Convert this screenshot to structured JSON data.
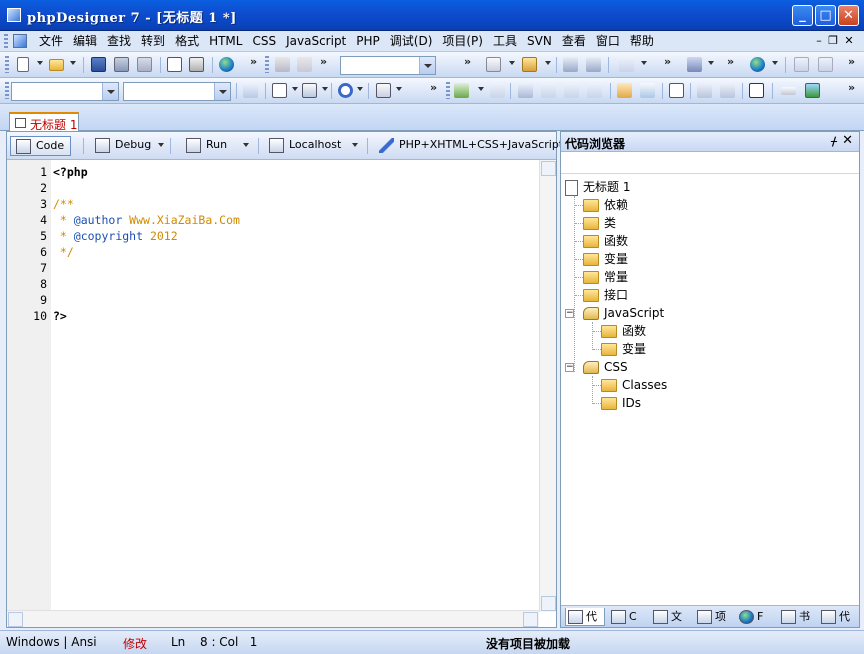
{
  "window": {
    "title": "phpDesigner 7 - [无标题 1 *]",
    "buttons": {
      "minimize": "_",
      "maximize": "□",
      "close": "✕"
    }
  },
  "menu": {
    "items": [
      "文件",
      "编辑",
      "查找",
      "转到",
      "格式",
      "HTML",
      "CSS",
      "JavaScript",
      "PHP",
      "调试(D)",
      "项目(P)",
      "工具",
      "SVN",
      "查看",
      "窗口",
      "帮助"
    ],
    "mdi_minimize": "–",
    "mdi_restore": "❐",
    "mdi_close": "✕"
  },
  "document_tab": {
    "label": "无标题 1"
  },
  "editor_toolbar": {
    "code_label": "Code",
    "debug_label": "Debug",
    "run_label": "Run",
    "localhost_label": "Localhost",
    "syntax_label": "PHP+XHTML+CSS+JavaScript"
  },
  "code_lines": [
    {
      "n": "1",
      "text": "<?php",
      "style": "kw"
    },
    {
      "n": "2",
      "text": "",
      "style": ""
    },
    {
      "n": "3",
      "text": "/**",
      "style": "cm"
    },
    {
      "n": "4",
      "text": " * @author Www.XiaZaiBa.Com",
      "style": "cm",
      "tag": "@author",
      "rest": " Www.XiaZaiBa.Com",
      "pre": " * "
    },
    {
      "n": "5",
      "text": " * @copyright 2012",
      "style": "cm",
      "tag": "@copyright",
      "rest": " 2012",
      "pre": " * "
    },
    {
      "n": "6",
      "text": " */",
      "style": "cm"
    },
    {
      "n": "7",
      "text": "",
      "style": ""
    },
    {
      "n": "8",
      "text": "",
      "style": ""
    },
    {
      "n": "9",
      "text": "",
      "style": ""
    },
    {
      "n": "10",
      "text": "?>",
      "style": "kw"
    }
  ],
  "code_browser": {
    "title": "代码浏览器",
    "pin": "ᚋ",
    "close": "✕",
    "root": "无标题 1",
    "php_items": [
      "依赖",
      "类",
      "函数",
      "变量",
      "常量",
      "接口"
    ],
    "js_group": "JavaScript",
    "js_items": [
      "函数",
      "变量"
    ],
    "css_group": "CSS",
    "css_items": [
      "Classes",
      "IDs"
    ],
    "bottom_tabs": [
      "代",
      "C",
      "文",
      "项",
      "F",
      "书",
      "代"
    ]
  },
  "status": {
    "encoding": "Windows | Ansi",
    "modified": "修改",
    "ln_label": "Ln",
    "position": "8 : Col   1",
    "project": "没有项目被加载"
  },
  "colors": {
    "title_bar": "#0a4fd0",
    "modified_text": "#c00000",
    "comment": "#d08a00",
    "doc_tag": "#1b4fb4"
  }
}
